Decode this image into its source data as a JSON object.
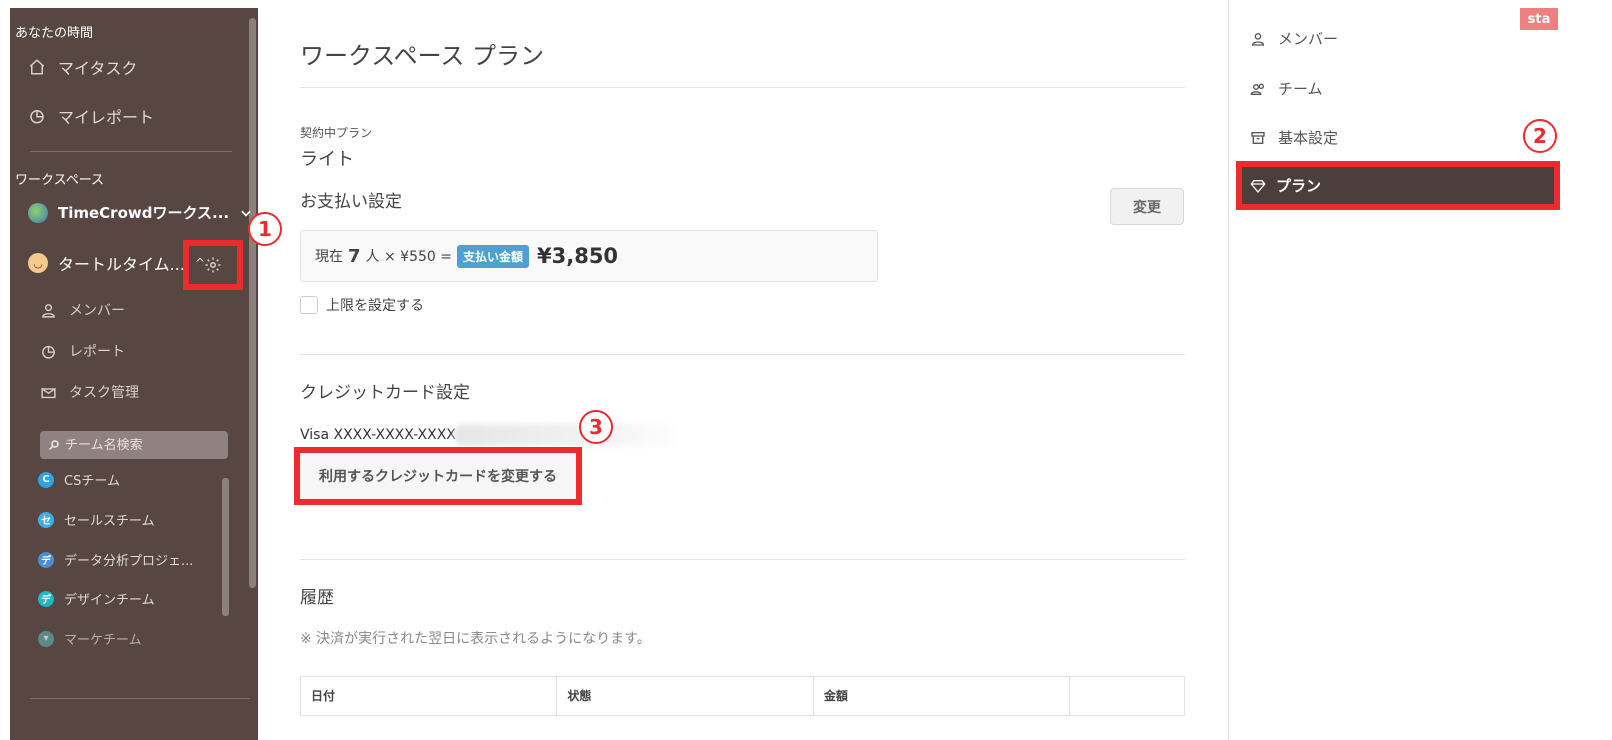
{
  "sidebar": {
    "your_time_title": "あなたの時間",
    "my_tasks": "マイタスク",
    "my_report": "マイレポート",
    "workspace_title": "ワークスペース",
    "workspace_name": "TimeCrowdワークス...",
    "team_name": "タートルタイム...",
    "sub_items": [
      "メンバー",
      "レポート",
      "タスク管理"
    ],
    "search_placeholder": "チーム名検索",
    "teams": [
      {
        "initial": "C",
        "name": "CSチーム",
        "color": "#2ea3e6"
      },
      {
        "initial": "セ",
        "name": "セールスチーム",
        "color": "#3bb0e0"
      },
      {
        "initial": "デ",
        "name": "データ分析プロジェ...",
        "color": "#4a8fd6"
      },
      {
        "initial": "デ",
        "name": "デザインチーム",
        "color": "#1cb8c8"
      },
      {
        "initial": "",
        "name": "マーケチーム",
        "color": "#5fa8a4"
      }
    ]
  },
  "annotations": {
    "one": "1",
    "two": "2",
    "three": "3"
  },
  "main": {
    "title": "ワークスペース プラン",
    "contract_label": "契約中プラン",
    "plan_name": "ライト",
    "payment_title": "お支払い設定",
    "change_button": "変更",
    "payment": {
      "prefix": "現在",
      "count": "7",
      "unit": "人 × ¥550 =",
      "badge": "支払い金額",
      "total": "¥3,850"
    },
    "limit_label": "上限を設定する",
    "credit_title": "クレジットカード設定",
    "card_number": "Visa XXXX-XXXX-XXXX",
    "card_button": "利用するクレジットカードを変更する",
    "history_title": "履歴",
    "history_note": "※ 決済が実行された翌日に表示されるようになります。",
    "table_headers": [
      "日付",
      "状態",
      "金額",
      ""
    ]
  },
  "right_panel": {
    "items": [
      "メンバー",
      "チーム",
      "基本設定"
    ],
    "active": "プラン",
    "badge": "sta"
  },
  "colors": {
    "sidebar_bg": "#574642",
    "highlight_red": "#ee2a2f",
    "badge_blue": "#4ea0d1"
  }
}
